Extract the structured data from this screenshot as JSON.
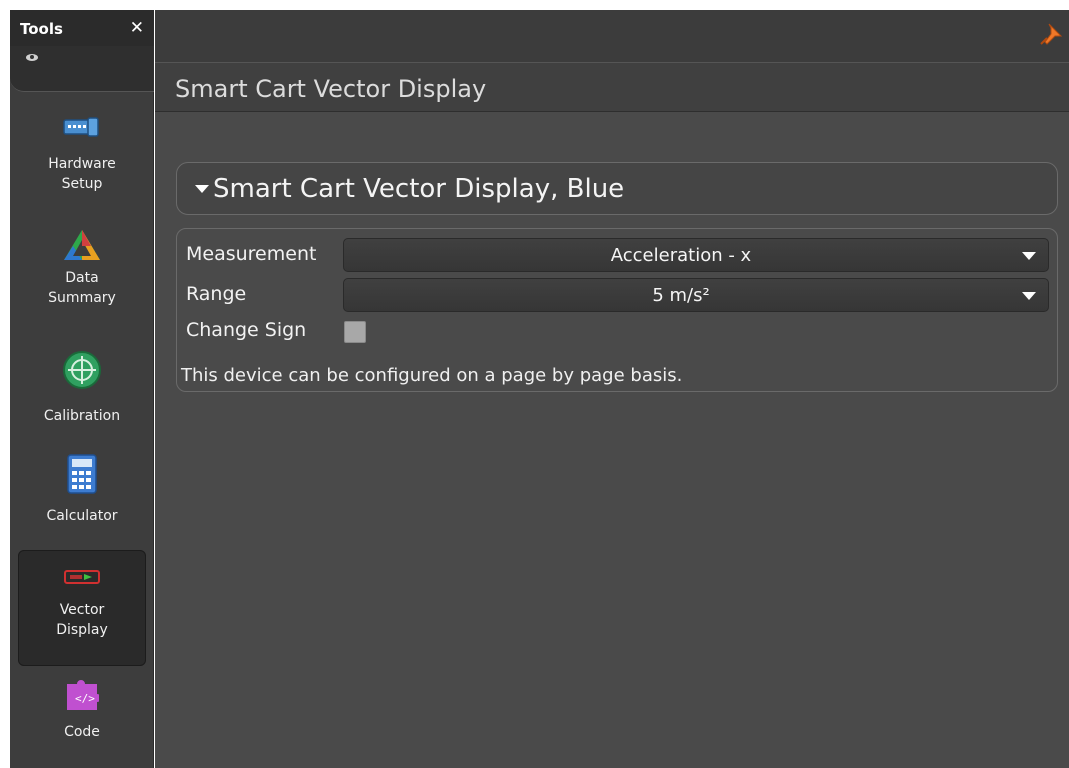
{
  "sidebar": {
    "title": "Tools",
    "close_label": "✕",
    "items": [
      {
        "label_lines": [
          "Hardware",
          "Setup"
        ],
        "icon": "hardware-icon"
      },
      {
        "label_lines": [
          "Data",
          "Summary"
        ],
        "icon": "data-summary-icon"
      },
      {
        "label_lines": [
          "Calibration"
        ],
        "icon": "calibration-icon"
      },
      {
        "label_lines": [
          "Calculator"
        ],
        "icon": "calculator-icon"
      },
      {
        "label_lines": [
          "Vector",
          "Display"
        ],
        "icon": "vector-display-icon",
        "active": true
      },
      {
        "label_lines": [
          "Code"
        ],
        "icon": "code-icon"
      }
    ]
  },
  "header": {
    "title": "Smart Cart Vector Display"
  },
  "section": {
    "title": "Smart Cart Vector Display, Blue",
    "measurement_label": "Measurement",
    "measurement_value": "Acceleration - x",
    "range_label": "Range",
    "range_value": "5 m/s²",
    "change_sign_label": "Change Sign",
    "change_sign_checked": false,
    "note": "This device can be configured on a page by page basis."
  },
  "colors": {
    "pin": "#f07828",
    "active_item_bg": "#2a2a2a"
  }
}
